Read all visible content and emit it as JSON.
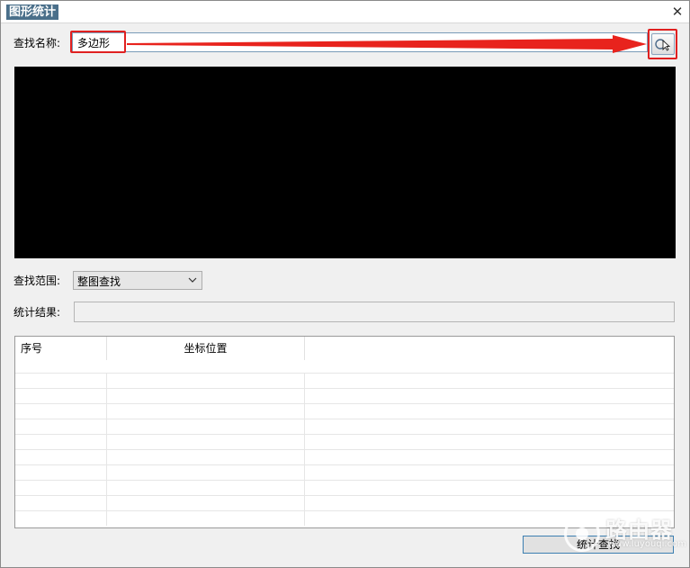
{
  "window": {
    "title": "图形统计",
    "close_glyph": "✕"
  },
  "search": {
    "label": "查找名称:",
    "value": "多边形"
  },
  "scope": {
    "label": "查找范围:",
    "selected": "整图查找"
  },
  "result": {
    "label": "统计结果:",
    "value": ""
  },
  "table": {
    "columns": [
      "序号",
      "坐标位置",
      ""
    ],
    "rows": []
  },
  "actions": {
    "stat_search_label": "统计查找"
  },
  "watermark": {
    "brand": "路由器",
    "url": "www.luyouqi.com"
  },
  "colors": {
    "highlight": "#e02020",
    "preview_bg": "#000000",
    "input_border": "#7a9cb8"
  },
  "icons": {
    "pick": "select-entity-icon",
    "dropdown": "chevron-down-icon",
    "close": "close-icon"
  }
}
